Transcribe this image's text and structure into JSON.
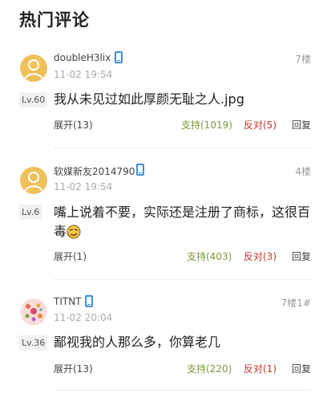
{
  "page": {
    "title": "热门评论"
  },
  "comments": [
    {
      "username": "doubleH3lix",
      "time": "11-02 19:54",
      "floor": "7楼",
      "level": "Lv.60",
      "content": "我从未见过如此厚颜无耻之人.jpg",
      "expand": "展开(13)",
      "support": "支持(1019)",
      "oppose": "反对(5)",
      "reply": "回复"
    },
    {
      "username": "软媒新友2014790",
      "time": "11-02 19:54",
      "floor": "4楼",
      "level": "Lv.6",
      "content": "嘴上说着不要，实际还是注册了商标，这很百毒",
      "expand": "展开(1)",
      "support": "支持(403)",
      "oppose": "反对(3)",
      "reply": "回复"
    },
    {
      "username": "TITNT",
      "time": "11-02 20:04",
      "floor": "7楼1#",
      "level": "Lv.36",
      "content": "鄙视我的人那么多，你算老几",
      "expand": "展开(13)",
      "support": "支持(220)",
      "oppose": "反对(1)",
      "reply": "回复"
    }
  ],
  "colors": {
    "support": "#7a9a3a",
    "oppose": "#c0392b",
    "phone": "#3f8fd8"
  },
  "icons": [
    "phone-icon",
    "default-avatar",
    "emoji-icon"
  ]
}
